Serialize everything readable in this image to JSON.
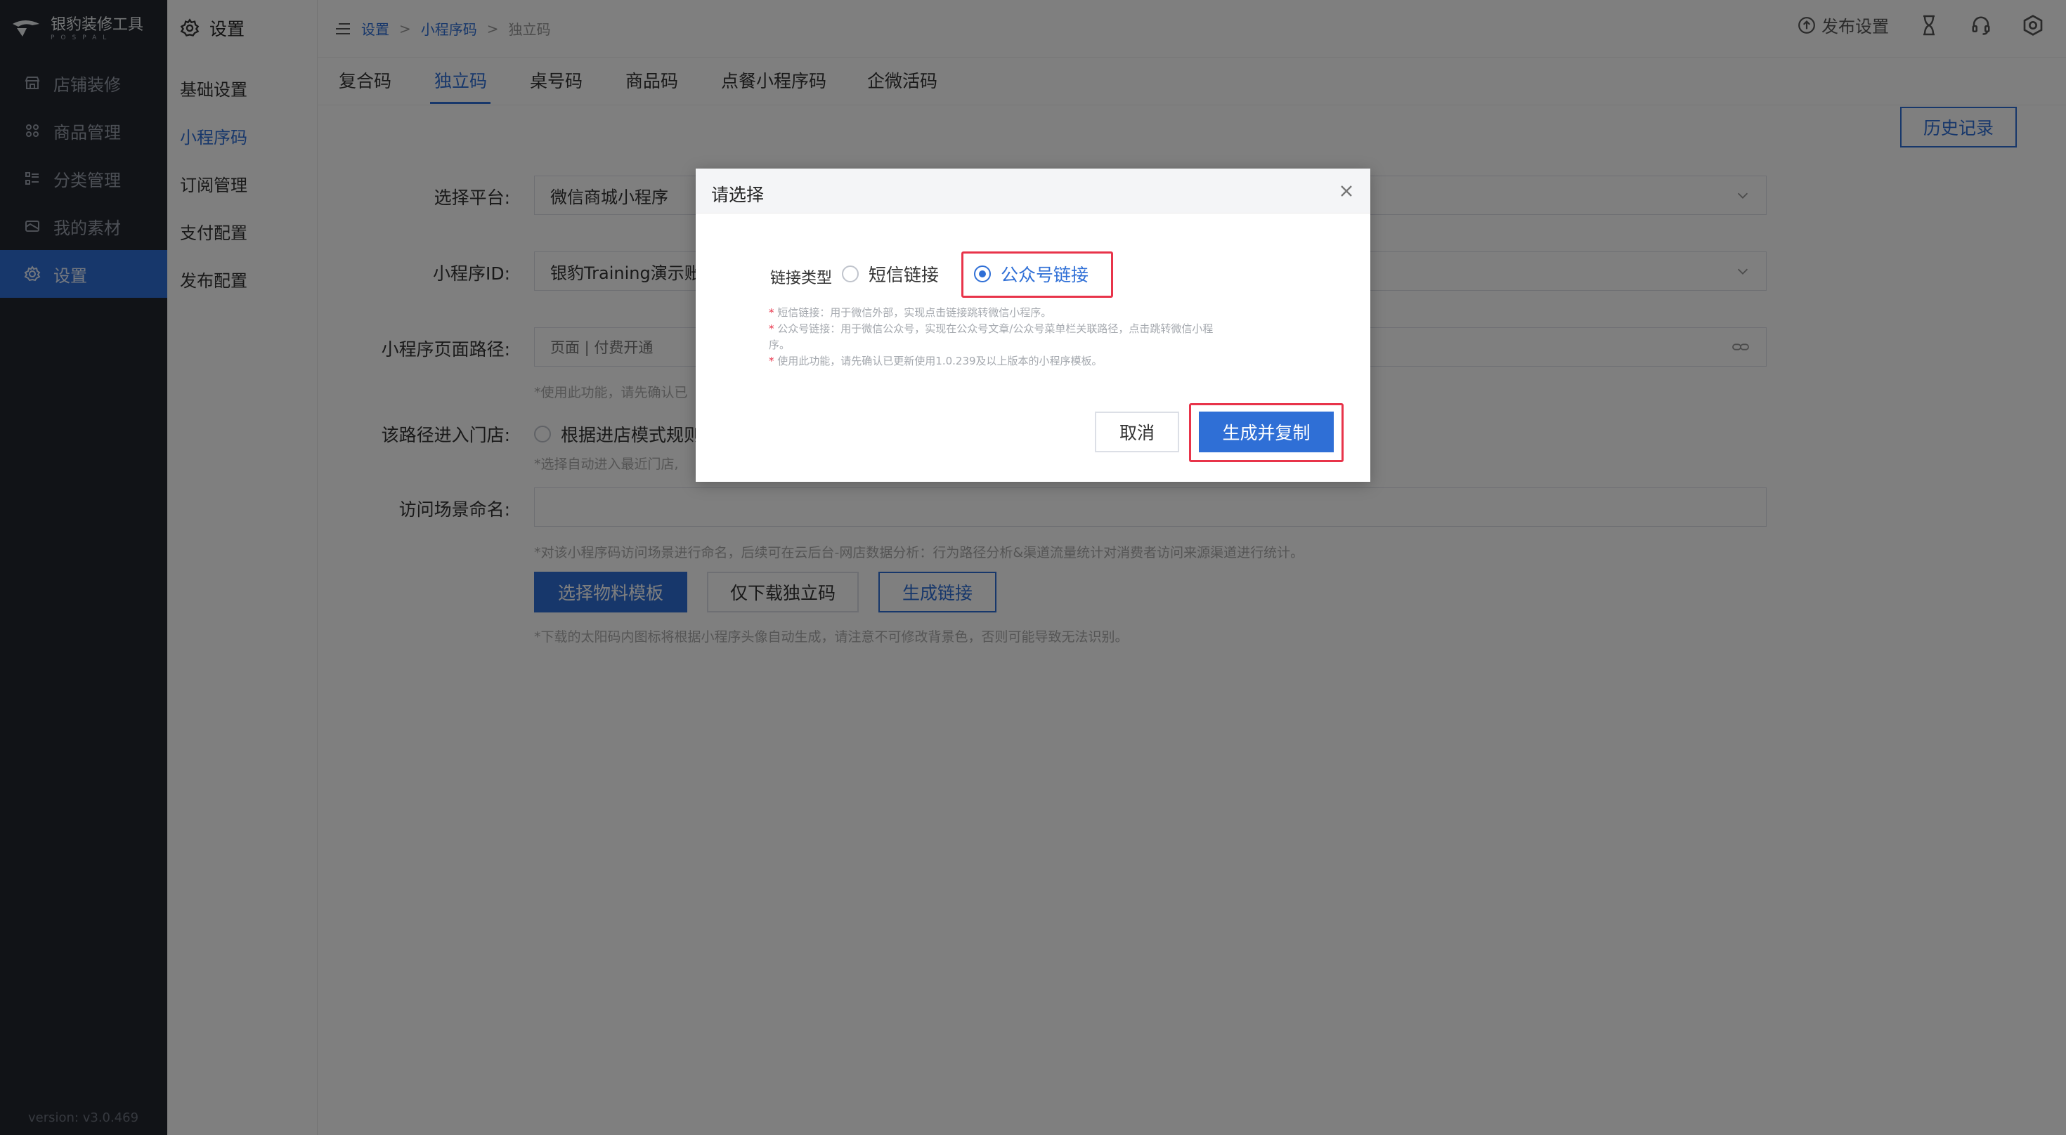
{
  "brand": {
    "name": "银豹装修工具",
    "sub": "POSPAL"
  },
  "sidebar": {
    "items": [
      {
        "label": "店铺装修",
        "icon": "store-icon"
      },
      {
        "label": "商品管理",
        "icon": "grid-icon"
      },
      {
        "label": "分类管理",
        "icon": "list-icon"
      },
      {
        "label": "我的素材",
        "icon": "image-icon"
      },
      {
        "label": "设置",
        "icon": "gear-icon",
        "active": true
      }
    ],
    "version": "version: v3.0.469"
  },
  "subnav": {
    "title": "设置",
    "items": [
      {
        "label": "基础设置"
      },
      {
        "label": "小程序码",
        "active": true
      },
      {
        "label": "订阅管理"
      },
      {
        "label": "支付配置"
      },
      {
        "label": "发布配置"
      }
    ]
  },
  "breadcrumb": {
    "root": "设置",
    "mid": "小程序码",
    "current": "独立码",
    "sep": ">"
  },
  "topbar": {
    "publish": "发布设置"
  },
  "tabs": [
    "复合码",
    "独立码",
    "桌号码",
    "商品码",
    "点餐小程序码",
    "企微活码"
  ],
  "history_button": "历史记录",
  "form": {
    "platform_label": "选择平台:",
    "platform_value": "微信商城小程序",
    "appid_label": "小程序ID:",
    "appid_value": "银豹Training演示账",
    "path_label": "小程序页面路径:",
    "path_value": "页面 | 付费开通",
    "path_hint": "*使用此功能，请先确认已",
    "store_label": "该路径进入门店:",
    "store_option": "根据进店模式规则",
    "store_hint": "*选择自动进入最近门店,",
    "scene_label": "访问场景命名:",
    "scene_value": "",
    "scene_hint": "*对该小程序码访问场景进行命名，后续可在云后台-网店数据分析：行为路径分析&渠道流量统计对消费者访问来源渠道进行统计。",
    "btn_template": "选择物料模板",
    "btn_download": "仅下载独立码",
    "btn_link": "生成链接",
    "bottom_hint": "*下载的太阳码内图标将根据小程序头像自动生成，请注意不可修改背景色，否则可能导致无法识别。"
  },
  "modal": {
    "title": "请选择",
    "link_type_label": "链接类型",
    "option_sms": "短信链接",
    "option_mp": "公众号链接",
    "notes": [
      "短信链接：用于微信外部，实现点击链接跳转微信小程序。",
      "公众号链接：用于微信公众号，实现在公众号文章/公众号菜单栏关联路径，点击跳转微信小程",
      "序。",
      "使用此功能，请先确认已更新使用1.0.239及以上版本的小程序模板。"
    ],
    "cancel": "取消",
    "confirm": "生成并复制"
  }
}
